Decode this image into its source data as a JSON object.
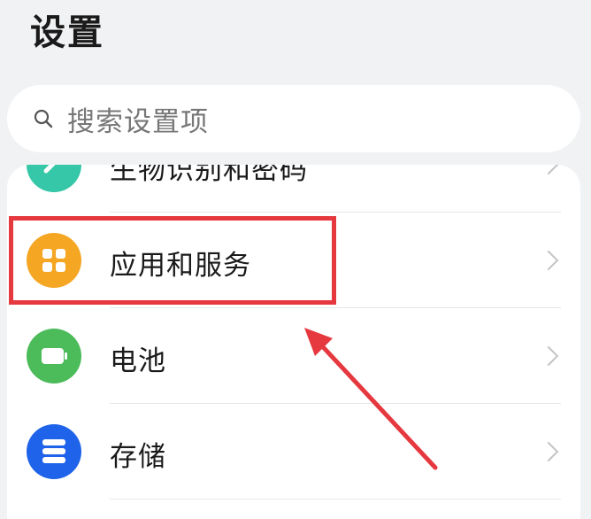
{
  "header": {
    "title": "设置"
  },
  "search": {
    "placeholder": "搜索设置项",
    "icon": "search-icon"
  },
  "settings_list": {
    "items": [
      {
        "label": "生物识别和密码",
        "icon": "fingerprint-icon",
        "icon_color": "#35c7a7"
      },
      {
        "label": "应用和服务",
        "icon": "apps-grid-icon",
        "icon_color": "#f5a623"
      },
      {
        "label": "电池",
        "icon": "battery-icon",
        "icon_color": "#4cbb5a"
      },
      {
        "label": "存储",
        "icon": "storage-icon",
        "icon_color": "#1e63e9"
      }
    ]
  },
  "annotation": {
    "highlight_color": "#e5393f"
  }
}
